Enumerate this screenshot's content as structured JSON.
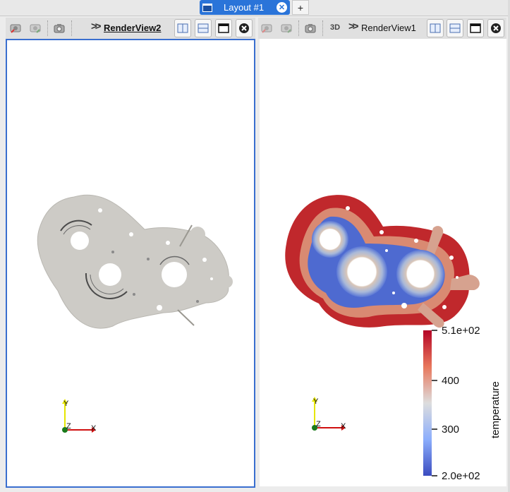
{
  "layout_tab": {
    "label": "Layout #1",
    "add_label": "+"
  },
  "left_view": {
    "title": "RenderView2",
    "active": true
  },
  "right_view": {
    "title": "RenderView1",
    "mode_label": "3D"
  },
  "axes": {
    "y": "Y",
    "z": "Z",
    "x": "X"
  },
  "colorbar": {
    "title": "temperature",
    "ticks": [
      "5.1e+02",
      "400",
      "300",
      "2.0e+02"
    ],
    "range": [
      200,
      510
    ],
    "colors": {
      "high": "#b40426",
      "mid": "#dddddd",
      "low": "#3b4cc0"
    }
  },
  "colors": {
    "accent": "#2a74d9",
    "selection_border": "#3a6fcf",
    "mesh_gray": "#cdcbc6"
  }
}
